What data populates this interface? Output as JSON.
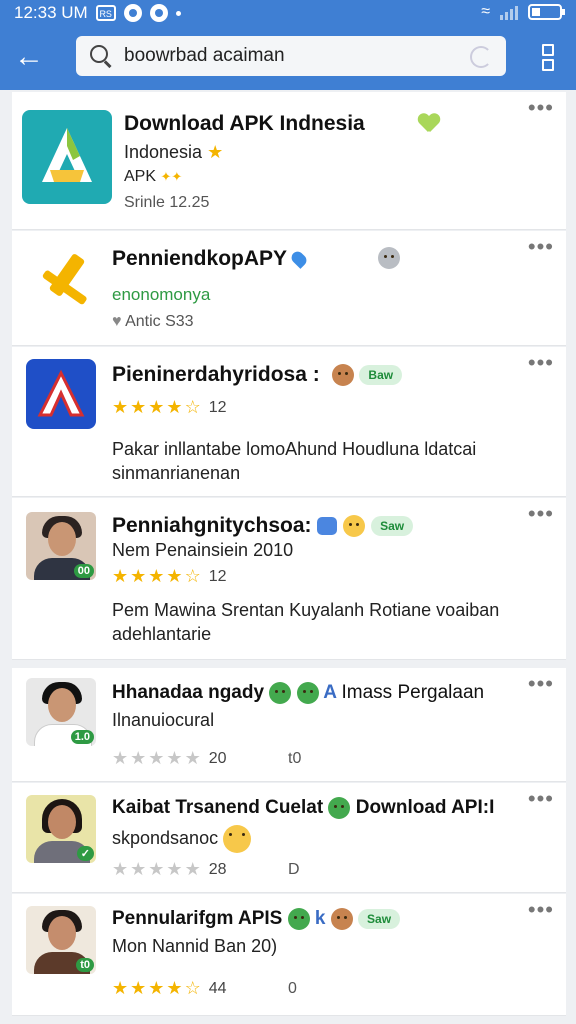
{
  "status_bar": {
    "time": "12:33 UM",
    "box_glyph": "RS"
  },
  "search": {
    "query": "boowrbad acaiman"
  },
  "colors": {
    "bar": "#3f7fd3",
    "star": "#f4b400",
    "badge": "#1e8c3a"
  },
  "cards": [
    {
      "title": "Download APK Indnesia",
      "line1": "Indonesia",
      "line2": "APK",
      "meta": "Srinle 12.25"
    },
    {
      "title": "PenniendkopAPY",
      "line1": "enonomonya",
      "meta": "Antic S33"
    },
    {
      "title": "Pieninerdahyridosa :",
      "badge": "Baw",
      "rating": "12",
      "desc": "Pakar inllantabe lomoAhund Houdluna ldatcai sinmanrianenan"
    },
    {
      "title": "Penniahgnitychsoa:",
      "badge": "Saw",
      "line1": "Nem Penainsiein 2010",
      "rating": "12",
      "desc": "Pem Mawina Srentan Kuyalanh Rotiane voaiban adehlantarie",
      "avatar_tag": "00"
    },
    {
      "title": "Hhanadaa ngady",
      "title_extra": "Imass Pergalaan",
      "line1": "Ilnanuiocural",
      "rating": "20",
      "extra": "t0",
      "avatar_tag": "1.0"
    },
    {
      "title": "Kaibat Trsanend Cuelat",
      "title_extra": "Download API:I",
      "line1": "skpondsanoc",
      "rating": "28",
      "extra": "D"
    },
    {
      "title": "Pennularifgm APIS",
      "badge": "Saw",
      "line1": "Mon Nannid Ban 20)",
      "rating": "44",
      "extra": "0",
      "avatar_tag": "t0"
    }
  ]
}
